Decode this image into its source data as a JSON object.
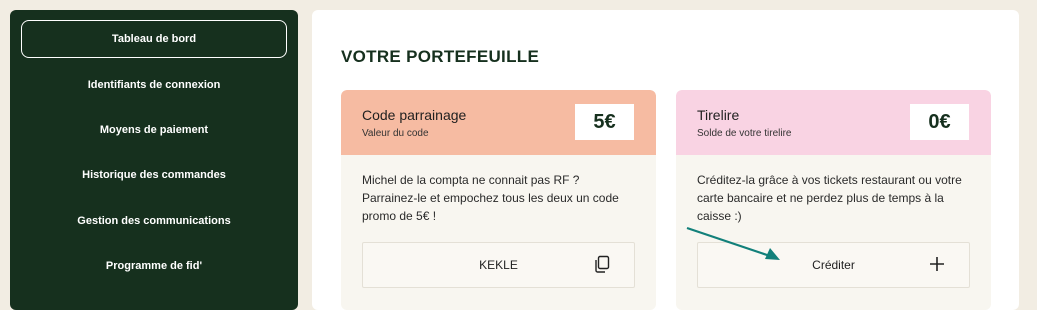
{
  "colors": {
    "sidebar_bg": "#16301e",
    "page_bg": "#f2ede3",
    "referral_header": "#f6bba2",
    "piggybank_header": "#f9d3e3",
    "arrow": "#12807a"
  },
  "sidebar": {
    "items": [
      {
        "label": "Tableau de bord",
        "active": true
      },
      {
        "label": "Identifiants de connexion"
      },
      {
        "label": "Moyens de paiement"
      },
      {
        "label": "Historique des commandes"
      },
      {
        "label": "Gestion des communications"
      },
      {
        "label": "Programme de fid'"
      }
    ]
  },
  "main": {
    "title": "VOTRE PORTEFEUILLE",
    "referral": {
      "title": "Code parrainage",
      "subtitle": "Valeur du code",
      "amount": "5€",
      "text": "Michel de la compta ne connait pas RF ? Parrainez-le et empochez tous les deux un code promo de 5€ !",
      "code": "KEKLE",
      "button_icon": "copy-icon"
    },
    "piggybank": {
      "title": "Tirelire",
      "subtitle": "Solde de votre tirelire",
      "amount": "0€",
      "text": "Créditez-la grâce à vos tickets restaurant ou votre carte bancaire et ne perdez plus de temps à la caisse :)",
      "button_label": "Créditer",
      "button_icon": "plus-icon"
    }
  }
}
